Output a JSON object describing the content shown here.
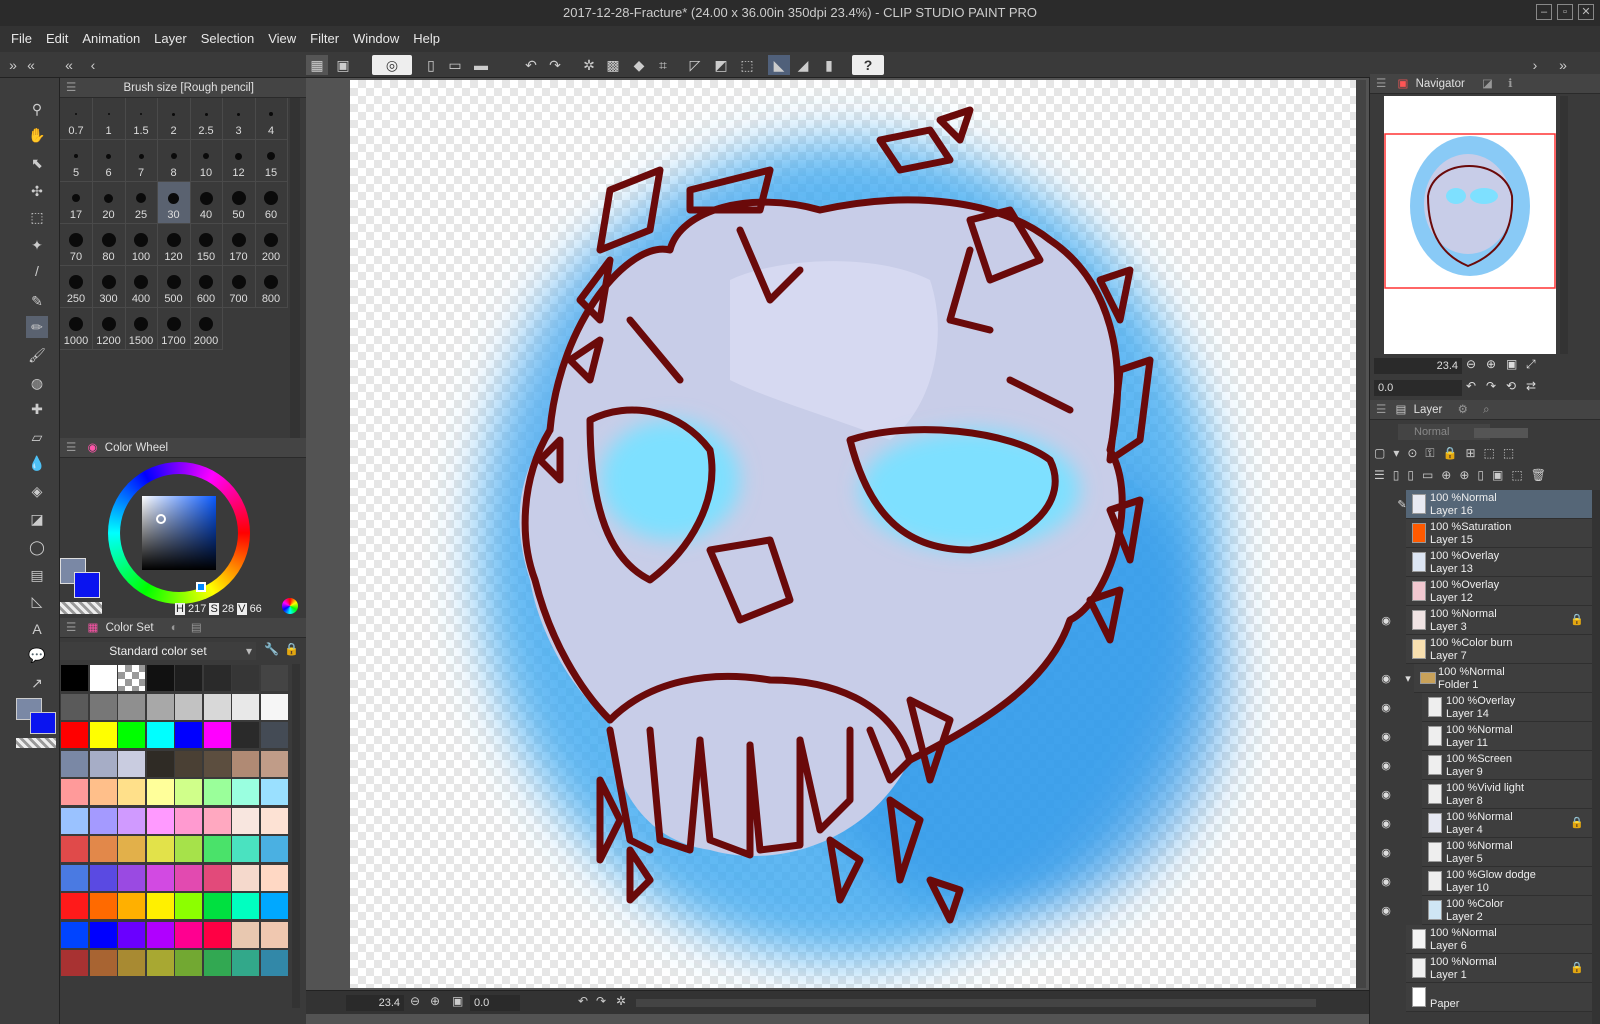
{
  "window": {
    "title": "2017-12-28-Fracture* (24.00 x 36.00in 350dpi 23.4%) - CLIP STUDIO PAINT PRO"
  },
  "menu": [
    "File",
    "Edit",
    "Animation",
    "Layer",
    "Selection",
    "View",
    "Filter",
    "Window",
    "Help"
  ],
  "brush_panel": {
    "title": "Brush size [Rough pencil]",
    "sizes": [
      "0.7",
      "1",
      "1.5",
      "2",
      "2.5",
      "3",
      "4",
      "5",
      "6",
      "7",
      "8",
      "10",
      "12",
      "15",
      "17",
      "20",
      "25",
      "30",
      "40",
      "50",
      "60",
      "70",
      "80",
      "100",
      "120",
      "150",
      "170",
      "200",
      "250",
      "300",
      "400",
      "500",
      "600",
      "700",
      "800",
      "1000",
      "1200",
      "1500",
      "1700",
      "2000"
    ],
    "selected": "30"
  },
  "color_wheel": {
    "title": "Color Wheel",
    "h_label": "H",
    "h": "217",
    "s_label": "S",
    "s": "28",
    "v_label": "V",
    "v": "66",
    "main_color": "#7a88a5",
    "sub_color": "#0a14f0"
  },
  "color_set": {
    "title": "Color Set",
    "set_name": "Standard color set",
    "swatches": [
      "#000000",
      "#ffffff",
      "checker",
      "#111111",
      "#1e1e1e",
      "#2a2a2a",
      "#363636",
      "#444444",
      "#5a5a5a",
      "#777777",
      "#8f8f8f",
      "#a8a8a8",
      "#c2c2c2",
      "#d8d8d8",
      "#e8e8e8",
      "#f6f6f6",
      "#ff0000",
      "#ffff00",
      "#00ff00",
      "#00ffff",
      "#0000ff",
      "#ff00ff",
      "#2a2a2a",
      "#444b55",
      "#7a88a5",
      "#a6adc6",
      "#c9cce0",
      "#2f2b25",
      "#4a4034",
      "#5c4e3f",
      "#b08a74",
      "#c09c88",
      "#ff9a9a",
      "#ffbf8a",
      "#ffe08a",
      "#ffff9a",
      "#d0ff8a",
      "#9aff9a",
      "#9affe0",
      "#9ae0ff",
      "#9ac2ff",
      "#a49aff",
      "#d09aff",
      "#ff9aff",
      "#ff9ad0",
      "#ffa8c0",
      "#f8e6df",
      "#fde2d4",
      "#e04a4a",
      "#e2884a",
      "#e2b04a",
      "#e2e24a",
      "#a6e24a",
      "#4ae26a",
      "#4ae2c0",
      "#4ab0e2",
      "#4a7ae2",
      "#5a4ae2",
      "#9a4ae2",
      "#d24ae2",
      "#e24ab0",
      "#e24a7a",
      "#f5d9cc",
      "#ffd8c4",
      "#ff1a1a",
      "#ff6a00",
      "#ffb000",
      "#fff000",
      "#8cff00",
      "#00e040",
      "#00ffc0",
      "#00a8ff",
      "#0044ff",
      "#0000ff",
      "#6a00ff",
      "#b000ff",
      "#ff0090",
      "#ff0044",
      "#e8c8b0",
      "#f0c8b0",
      "#a83232",
      "#a86432",
      "#a88a32",
      "#a8a832",
      "#72a832",
      "#32a852",
      "#32a88a",
      "#3288a8"
    ]
  },
  "navigator": {
    "title": "Navigator",
    "zoom": "23.4",
    "angle": "0.0"
  },
  "layer_panel": {
    "title": "Layer",
    "blend_mode": "Normal",
    "layers": [
      {
        "line1": "100 %Normal",
        "line2": "Layer 16",
        "visible": false,
        "selected": true,
        "locked": false,
        "indent": 0,
        "thumb": "#e8eaf2"
      },
      {
        "line1": "100 %Saturation",
        "line2": "Layer 15",
        "visible": false,
        "selected": false,
        "locked": false,
        "indent": 0,
        "thumb": "#ff5a00"
      },
      {
        "line1": "100 %Overlay",
        "line2": "Layer 13",
        "visible": false,
        "selected": false,
        "locked": false,
        "indent": 0,
        "thumb": "#dde6f4"
      },
      {
        "line1": "100 %Overlay",
        "line2": "Layer 12",
        "visible": false,
        "selected": false,
        "locked": false,
        "indent": 0,
        "thumb": "#f2c8d0"
      },
      {
        "line1": "100 %Normal",
        "line2": "Layer 3",
        "visible": true,
        "selected": false,
        "locked": true,
        "indent": 0,
        "thumb": "#f0e4e4"
      },
      {
        "line1": "100 %Color burn",
        "line2": "Layer 7",
        "visible": false,
        "selected": false,
        "locked": false,
        "indent": 0,
        "thumb": "#f8e0b0"
      },
      {
        "line1": "100 %Normal",
        "line2": "Folder 1",
        "visible": true,
        "selected": false,
        "locked": false,
        "indent": 1,
        "thumb": "folder"
      },
      {
        "line1": "100 %Overlay",
        "line2": "Layer 14",
        "visible": true,
        "selected": false,
        "locked": false,
        "indent": 2,
        "thumb": "#eeeeee"
      },
      {
        "line1": "100 %Normal",
        "line2": "Layer 11",
        "visible": true,
        "selected": false,
        "locked": false,
        "indent": 2,
        "thumb": "#eeeeee"
      },
      {
        "line1": "100 %Screen",
        "line2": "Layer 9",
        "visible": true,
        "selected": false,
        "locked": false,
        "indent": 2,
        "thumb": "#eeeeee"
      },
      {
        "line1": "100 %Vivid light",
        "line2": "Layer 8",
        "visible": true,
        "selected": false,
        "locked": false,
        "indent": 2,
        "thumb": "#eeeeee"
      },
      {
        "line1": "100 %Normal",
        "line2": "Layer 4",
        "visible": true,
        "selected": false,
        "locked": true,
        "indent": 2,
        "thumb": "#e6e8f2"
      },
      {
        "line1": "100 %Normal",
        "line2": "Layer 5",
        "visible": true,
        "selected": false,
        "locked": false,
        "indent": 2,
        "thumb": "#eeeeee"
      },
      {
        "line1": "100 %Glow dodge",
        "line2": "Layer 10",
        "visible": true,
        "selected": false,
        "locked": false,
        "indent": 2,
        "thumb": "#eeeeee"
      },
      {
        "line1": "100 %Color",
        "line2": "Layer 2",
        "visible": true,
        "selected": false,
        "locked": false,
        "indent": 2,
        "thumb": "#cfe6f4"
      },
      {
        "line1": "100 %Normal",
        "line2": "Layer 6",
        "visible": false,
        "selected": false,
        "locked": false,
        "indent": 0,
        "thumb": "#f4f4f4"
      },
      {
        "line1": "100 %Normal",
        "line2": "Layer 1",
        "visible": false,
        "selected": false,
        "locked": true,
        "indent": 0,
        "thumb": "#f0f0f0"
      },
      {
        "line1": "",
        "line2": "Paper",
        "visible": false,
        "selected": false,
        "locked": false,
        "indent": 0,
        "thumb": "#ffffff"
      }
    ]
  },
  "status": {
    "zoom": "23.4",
    "angle": "0.0"
  },
  "colors": {
    "lineart": "#6a0a0a",
    "glow": "#3aa6f0",
    "skull": "#c8cde8",
    "eye": "#7ee0ff"
  }
}
